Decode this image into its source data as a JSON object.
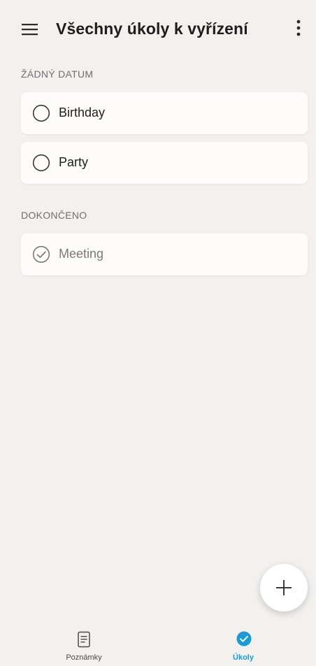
{
  "header": {
    "title": "Všechny úkoly k vyřízení",
    "menu_icon": "hamburger-menu-icon",
    "more_icon": "more-vertical-icon"
  },
  "sections": [
    {
      "label": "ŽÁDNÝ DATUM",
      "tasks": [
        {
          "title": "Birthday",
          "done": false
        },
        {
          "title": "Party",
          "done": false
        }
      ]
    },
    {
      "label": "DOKONČENO",
      "tasks": [
        {
          "title": "Meeting",
          "done": true
        }
      ]
    }
  ],
  "fab": {
    "icon": "plus-icon"
  },
  "bottom_nav": {
    "items": [
      {
        "label": "Poznámky",
        "icon": "note-icon",
        "active": false
      },
      {
        "label": "Úkoly",
        "icon": "check-circle-icon",
        "active": true
      }
    ]
  },
  "colors": {
    "background": "#f3f1ee",
    "card": "#fdfcfa",
    "accent": "#1a9bd7"
  }
}
